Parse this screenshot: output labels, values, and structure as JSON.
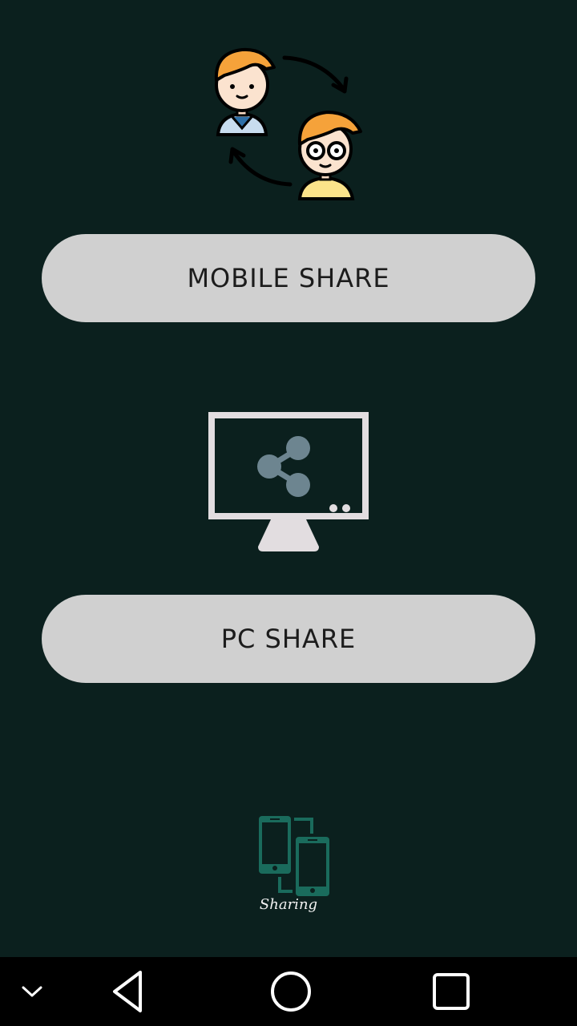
{
  "buttons": {
    "mobile_share": "MOBILE SHARE",
    "pc_share": "PC SHARE"
  },
  "logo": {
    "caption": "Sharing"
  },
  "colors": {
    "background": "#0b201e",
    "button": "#d0d0d0",
    "button_text": "#1c1c1c",
    "logo_teal": "#1a6b5c",
    "share_icon": "#6d8590",
    "monitor": "#e2dde0"
  },
  "icons": {
    "people_exchange": "people-exchange-illustration",
    "monitor_share": "monitor-share-illustration",
    "app_logo": "phones-transfer-logo",
    "nav": [
      "chevron-down-icon",
      "back-triangle-icon",
      "home-circle-icon",
      "recents-square-icon"
    ]
  }
}
